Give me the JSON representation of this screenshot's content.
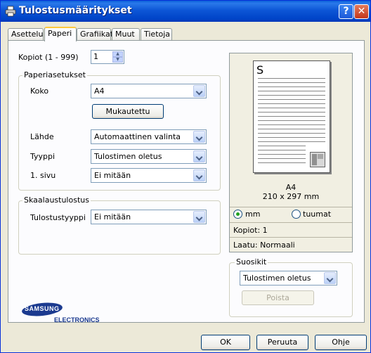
{
  "window": {
    "title": "Tulostusmääritykset",
    "help_label": "?",
    "close_label": "✕"
  },
  "tabs": [
    {
      "label": "Asettelu",
      "active": false
    },
    {
      "label": "Paperi",
      "active": true
    },
    {
      "label": "Grafiikat",
      "active": false
    },
    {
      "label": "Muut",
      "active": false
    },
    {
      "label": "Tietoja",
      "active": false
    }
  ],
  "copies": {
    "label": "Kopiot (1 - 999)",
    "value": "1"
  },
  "paper_settings": {
    "title": "Paperiasetukset",
    "size_label": "Koko",
    "size_value": "A4",
    "custom_button": "Mukautettu",
    "source_label": "Lähde",
    "source_value": "Automaattinen valinta",
    "type_label": "Tyyppi",
    "type_value": "Tulostimen oletus",
    "first_page_label": "1. sivu",
    "first_page_value": "Ei mitään"
  },
  "scaling": {
    "title": "Skaalaustulostus",
    "type_label": "Tulostustyyppi",
    "type_value": "Ei mitään"
  },
  "preview": {
    "page_letter": "S",
    "paper_name": "A4",
    "paper_dims": "210 x 297 mm",
    "unit_mm": "mm",
    "unit_inch": "tuumat",
    "selected_unit": "mm",
    "copies_text": "Kopiot: 1",
    "quality_text": "Laatu: Normaali"
  },
  "favorites": {
    "title": "Suosikit",
    "value": "Tulostimen oletus",
    "delete_button": "Poista"
  },
  "logo": {
    "brand": "SAMSUNG",
    "sub": "ELECTRONICS"
  },
  "footer": {
    "ok": "OK",
    "cancel": "Peruuta",
    "help": "Ohje"
  }
}
